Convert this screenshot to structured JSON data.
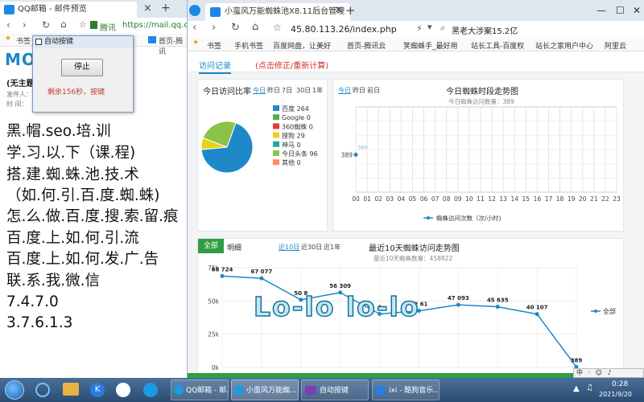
{
  "left_window": {
    "tab_title": "QQ邮箱 - 邮件预览",
    "url_prefix": "腾讯",
    "url": "https://mail.qq.c",
    "bookmark_1": "书签",
    "bookmark_2": "首页-腾讯",
    "page_title": "(无主题",
    "sender_label": "发件人：",
    "time_label": "时    间：",
    "logo": "MO",
    "lines": [
      "黑.帽.seo.培.训",
      "学.习.以.下（课.程)",
      "搭.建.蜘.蛛.池.技.术",
      "（如.何.引.百.度.蜘.蛛)",
      "怎.么.做.百.度.搜.索.留.痕",
      "百.度.上.如.何.引.流",
      "百.度.上.如.何.发.广.告",
      "联.系.我.微.信",
      "7.4.7.0",
      "3.7.6.1.3"
    ]
  },
  "dialog": {
    "title": "自动按键",
    "button": "停止",
    "status": "剩余156秒，按键"
  },
  "right_window": {
    "tab_title": "小蛮风万能蜘蛛池X8.11后台管理",
    "url": "45.80.113.26/index.php",
    "search_hint": "黑老大涉案15.2亿",
    "bookmarks": [
      "书签",
      "手机书签",
      "百度网盘，让美好",
      "首页-腾讯云",
      "笑蜘蛛手_最好用",
      "站长工具-百度权",
      "站长之家用户中心",
      "阿里云"
    ],
    "tabs": [
      "访问记录",
      "(点击修正/重新计算)"
    ],
    "pie_panel": {
      "title": "今日访问比率",
      "filters": [
        "今日",
        "昨日",
        "7日",
        "30日",
        "1年"
      ]
    },
    "hour_panel": {
      "filters": [
        "今日",
        "昨日",
        "前日"
      ],
      "title": "今日蜘蛛时段走势图",
      "subtitle": "今日蜘蛛访问数量：389",
      "legend": "蜘蛛访问次数（次/小时)"
    },
    "day_panel": {
      "tabs": [
        "全部",
        "明细"
      ],
      "filters": [
        "近10日",
        "近30日",
        "近1年"
      ],
      "title": "最近10天蜘蛛访问走势图",
      "subtitle": "最近10天蜘蛛数量：458822",
      "legend": "全部"
    },
    "watermark": "Lo-lo lo-lo"
  },
  "taskbar": {
    "items": [
      "QQ邮箱 - 邮...",
      "小蛮风万能蜘...",
      "自动按键",
      "ixi - 酷狗音乐..."
    ],
    "time": "0:28",
    "date": "2021/9/20",
    "ime": "中"
  },
  "chart_data": [
    {
      "type": "pie",
      "categories": [
        "百度",
        "Google",
        "360蜘蛛",
        "搜狗",
        "神马",
        "今日头条",
        "其他"
      ],
      "values": [
        264,
        0,
        0,
        29,
        0,
        96,
        0
      ],
      "colors": [
        "#1e88c8",
        "#4caf50",
        "#e53935",
        "#e8d31a",
        "#26a69a",
        "#8bc34a",
        "#ff8a65"
      ]
    },
    {
      "type": "line",
      "x": [
        "00",
        "01",
        "02",
        "03",
        "04",
        "05",
        "06",
        "07",
        "08",
        "09",
        "10",
        "11",
        "12",
        "13",
        "14",
        "15",
        "16",
        "17",
        "18",
        "19",
        "20",
        "21",
        "22",
        "23"
      ],
      "series": [
        {
          "name": "蜘蛛访问次数（次/小时)",
          "values": [
            389
          ]
        }
      ],
      "y_tick": 389,
      "data_label": "389"
    },
    {
      "type": "line",
      "ylim": [
        0,
        75000
      ],
      "y_ticks": [
        "0k",
        "25k",
        "50k",
        "75k"
      ],
      "series": [
        {
          "name": "全部",
          "values": [
            68724,
            67077,
            50880,
            56309,
            40200,
            42600,
            47093,
            45635,
            40107,
            389
          ]
        }
      ],
      "data_labels": [
        "68 724",
        "67 077",
        "50 8",
        "56 309",
        "4",
        "42 61",
        "47 093",
        "45 635",
        "40 107",
        "389"
      ]
    }
  ]
}
